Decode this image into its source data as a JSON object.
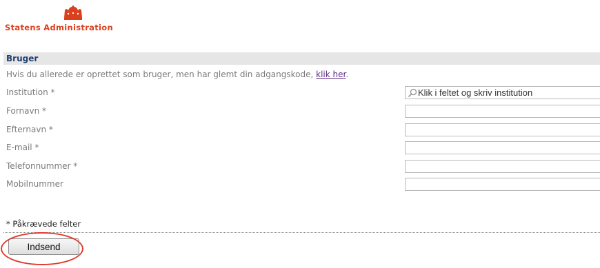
{
  "brand": {
    "logo_text": "Statens Administration",
    "crown_icon": "crown-icon",
    "brand_color": "#d9411e"
  },
  "section": {
    "title": "Bruger",
    "title_color": "#1f3f72"
  },
  "help": {
    "text": "Hvis du allerede er oprettet som bruger, men har glemt din adgangskode, ",
    "link_label": "klik her",
    "suffix": "."
  },
  "form": {
    "institution_label": "Institution *",
    "institution_placeholder": "Klik i feltet og skriv institution",
    "search_icon": "magnifier-icon",
    "fornavn_label": "Fornavn *",
    "fornavn_value": "",
    "efternavn_label": "Efternavn *",
    "efternavn_value": "",
    "email_label": "E-mail *",
    "email_value": "",
    "telefon_label": "Telefonnummer *",
    "telefon_value": "",
    "mobil_label": "Mobilnummer",
    "mobil_value": ""
  },
  "footer": {
    "required_note": "* Påkrævede felter",
    "submit_label": "Indsend",
    "highlight_color": "#e23a2e"
  }
}
